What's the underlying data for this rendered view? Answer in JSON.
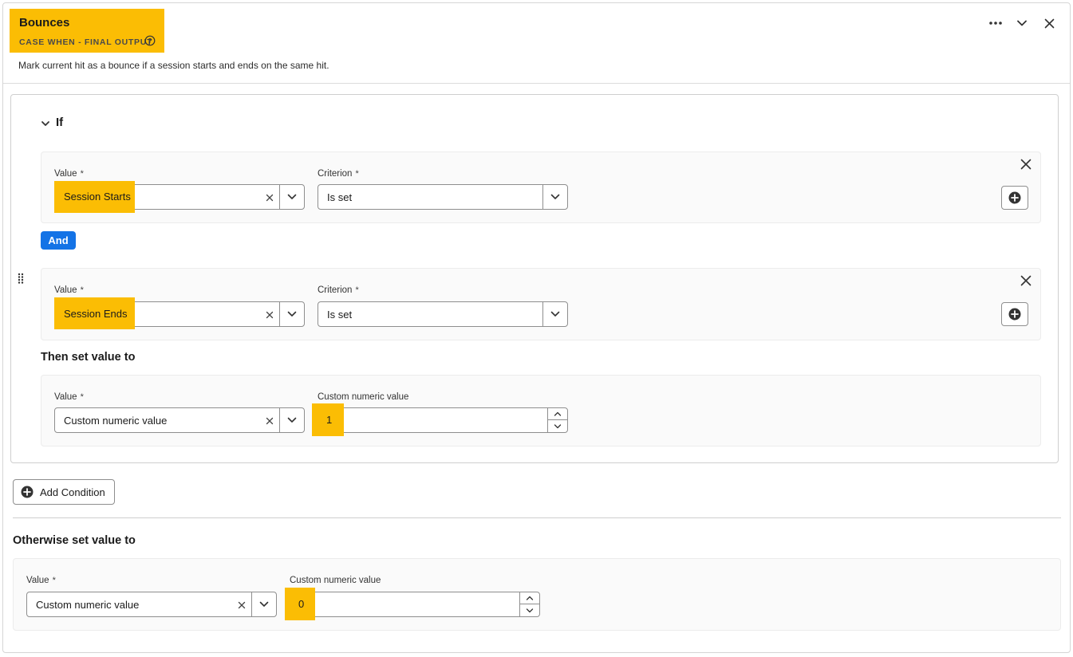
{
  "header": {
    "title": "Bounces",
    "subtitle": "CASE WHEN - FINAL OUTPUT",
    "description": "Mark current hit as a bounce if a session starts and ends on the same hit."
  },
  "if_section": {
    "label": "If",
    "conditions": [
      {
        "value_label": "Value",
        "value": "Session Starts",
        "criterion_label": "Criterion",
        "criterion": "Is set"
      },
      {
        "value_label": "Value",
        "value": "Session Ends",
        "criterion_label": "Criterion",
        "criterion": "Is set"
      }
    ],
    "operator": "And",
    "required_mark": "*"
  },
  "then_section": {
    "title": "Then set value to",
    "value_label": "Value",
    "value": "Custom numeric value",
    "custom_label": "Custom numeric value",
    "custom_value": "1"
  },
  "add_condition_label": "Add Condition",
  "otherwise_section": {
    "title": "Otherwise set value to",
    "value_label": "Value",
    "value": "Custom numeric value",
    "custom_label": "Custom numeric value",
    "custom_value": "0"
  },
  "colors": {
    "highlight": "#fbbd04",
    "accent_blue": "#1473e6"
  }
}
